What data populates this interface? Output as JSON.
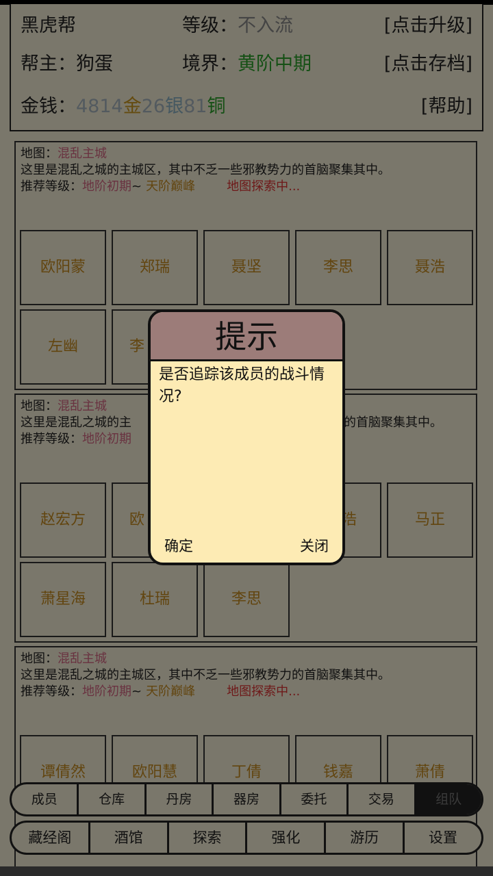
{
  "header": {
    "gang_label": "黑虎帮",
    "level_label": "等级：",
    "level_value": "不入流",
    "upgrade_btn": "[点击升级]",
    "leader_label": "帮主：",
    "leader_name": "狗蛋",
    "realm_label": "境界：",
    "realm_value": "黄阶中期",
    "save_btn": "[点击存档]",
    "money_label": "金钱：",
    "gold_amount": "4814",
    "gold_unit": "金",
    "silver_amount": "26",
    "silver_unit": "银",
    "copper_amount": "81",
    "copper_unit": "铜",
    "help_btn": "[帮助]"
  },
  "panels": [
    {
      "map_label": "地图：",
      "map_name": "混乱主城",
      "desc": "这里是混乱之城的主城区，其中不乏一些邪教势力的首脑聚集其中。",
      "rec_label": "推荐等级：",
      "rec_min": "地阶初期",
      "rec_sep": "~",
      "rec_max": "天阶巅峰",
      "status": "地图探索中...",
      "members": [
        "欧阳蒙",
        "郑瑞",
        "聂坚",
        "李思",
        "聂浩",
        "左幽",
        "李"
      ]
    },
    {
      "map_label": "地图：",
      "map_name": "混乱主城",
      "desc": "这里是混乱之城的主",
      "desc_tail": "的首脑聚集其中。",
      "rec_label": "推荐等级：",
      "rec_min": "地阶初期",
      "members": [
        "赵宏方",
        "欧",
        "浩",
        "马正",
        "萧星海",
        "杜瑞",
        "李思"
      ]
    },
    {
      "map_label": "地图：",
      "map_name": "混乱主城",
      "desc": "这里是混乱之城的主城区，其中不乏一些邪教势力的首脑聚集其中。",
      "rec_label": "推荐等级：",
      "rec_min": "地阶初期",
      "rec_sep": "~",
      "rec_max": "天阶巅峰",
      "status": "地图探索中...",
      "members": [
        "谭倩然",
        "欧阳慧",
        "丁倩",
        "钱嘉",
        "萧倩"
      ]
    }
  ],
  "tabs_row1": [
    "成员",
    "仓库",
    "丹房",
    "器房",
    "委托",
    "交易",
    "组队"
  ],
  "tabs_row2": [
    "藏经阁",
    "酒馆",
    "探索",
    "强化",
    "游历",
    "设置"
  ],
  "dialog": {
    "title": "提示",
    "message": "是否追踪该成员的战斗情况?",
    "ok": "确定",
    "close": "关闭"
  },
  "colors": {
    "background": "#f5eed7",
    "member_text": "#c58a1e",
    "map_name": "#d26580",
    "status": "#d33333",
    "realm": "#2aa12a",
    "dialog_bg": "#fdebb4",
    "dialog_title_bg": "#9c7c79"
  }
}
